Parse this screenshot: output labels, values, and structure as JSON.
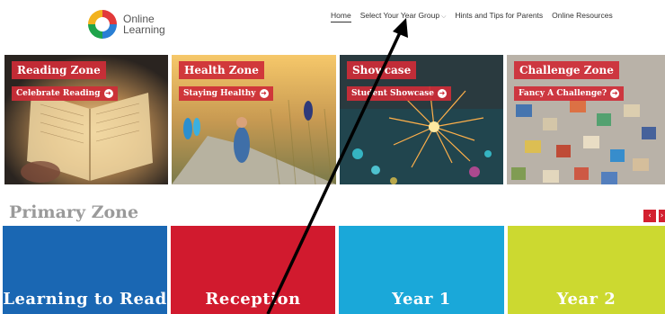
{
  "header": {
    "logo_line1": "Online",
    "logo_line2": "Learning",
    "nav": [
      {
        "label": "Home",
        "active": true
      },
      {
        "label": "Select Your Year Group",
        "dropdown": true
      },
      {
        "label": "Hints and Tips for Parents"
      },
      {
        "label": "Online Resources"
      }
    ]
  },
  "zones": [
    {
      "title": "Reading Zone",
      "button": "Celebrate Reading"
    },
    {
      "title": "Health Zone",
      "button": "Staying Healthy"
    },
    {
      "title": "Showcase",
      "button": "Student Showcase"
    },
    {
      "title": "Challenge Zone",
      "button": "Fancy A Challenge?"
    }
  ],
  "primary": {
    "heading": "Primary Zone",
    "prev_icon": "‹",
    "next_icon": "›",
    "tiles": [
      {
        "label": "Learning to Read",
        "color": "#1a67b3"
      },
      {
        "label": "Reception",
        "color": "#d11a2e"
      },
      {
        "label": "Year 1",
        "color": "#1aa8d9"
      },
      {
        "label": "Year 2",
        "color": "#ccd930"
      }
    ]
  },
  "colors": {
    "accent_red": "#ce2d37"
  },
  "arrow_button_icon": "➜"
}
